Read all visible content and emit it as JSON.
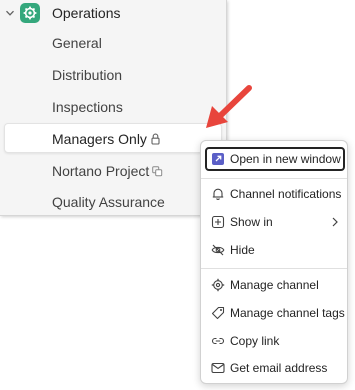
{
  "team": {
    "name": "Operations",
    "icon": "gear-icon",
    "color": "#34a77c"
  },
  "channels": [
    {
      "label": "General"
    },
    {
      "label": "Distribution"
    },
    {
      "label": "Inspections"
    },
    {
      "label": "Managers Only",
      "icon": "lock-icon"
    },
    {
      "label": "Nortano Project",
      "icon": "shared-channel-icon"
    },
    {
      "label": "Quality Assurance"
    }
  ],
  "more_options": "...",
  "context_menu": {
    "items": [
      {
        "label": "Open in new window",
        "icon": "open-window-icon"
      },
      {
        "label": "Channel notifications",
        "icon": "bell-icon"
      },
      {
        "label": "Show in",
        "icon": "add-box-icon"
      },
      {
        "label": "Hide",
        "icon": "eye-off-icon"
      },
      {
        "label": "Manage channel",
        "icon": "gear-icon"
      },
      {
        "label": "Manage channel tags",
        "icon": "tag-icon"
      },
      {
        "label": "Copy link",
        "icon": "link-icon"
      },
      {
        "label": "Get email address",
        "icon": "mail-icon"
      }
    ]
  },
  "colors": {
    "accent": "#5b5fc7",
    "arrow": "#e8453c"
  }
}
